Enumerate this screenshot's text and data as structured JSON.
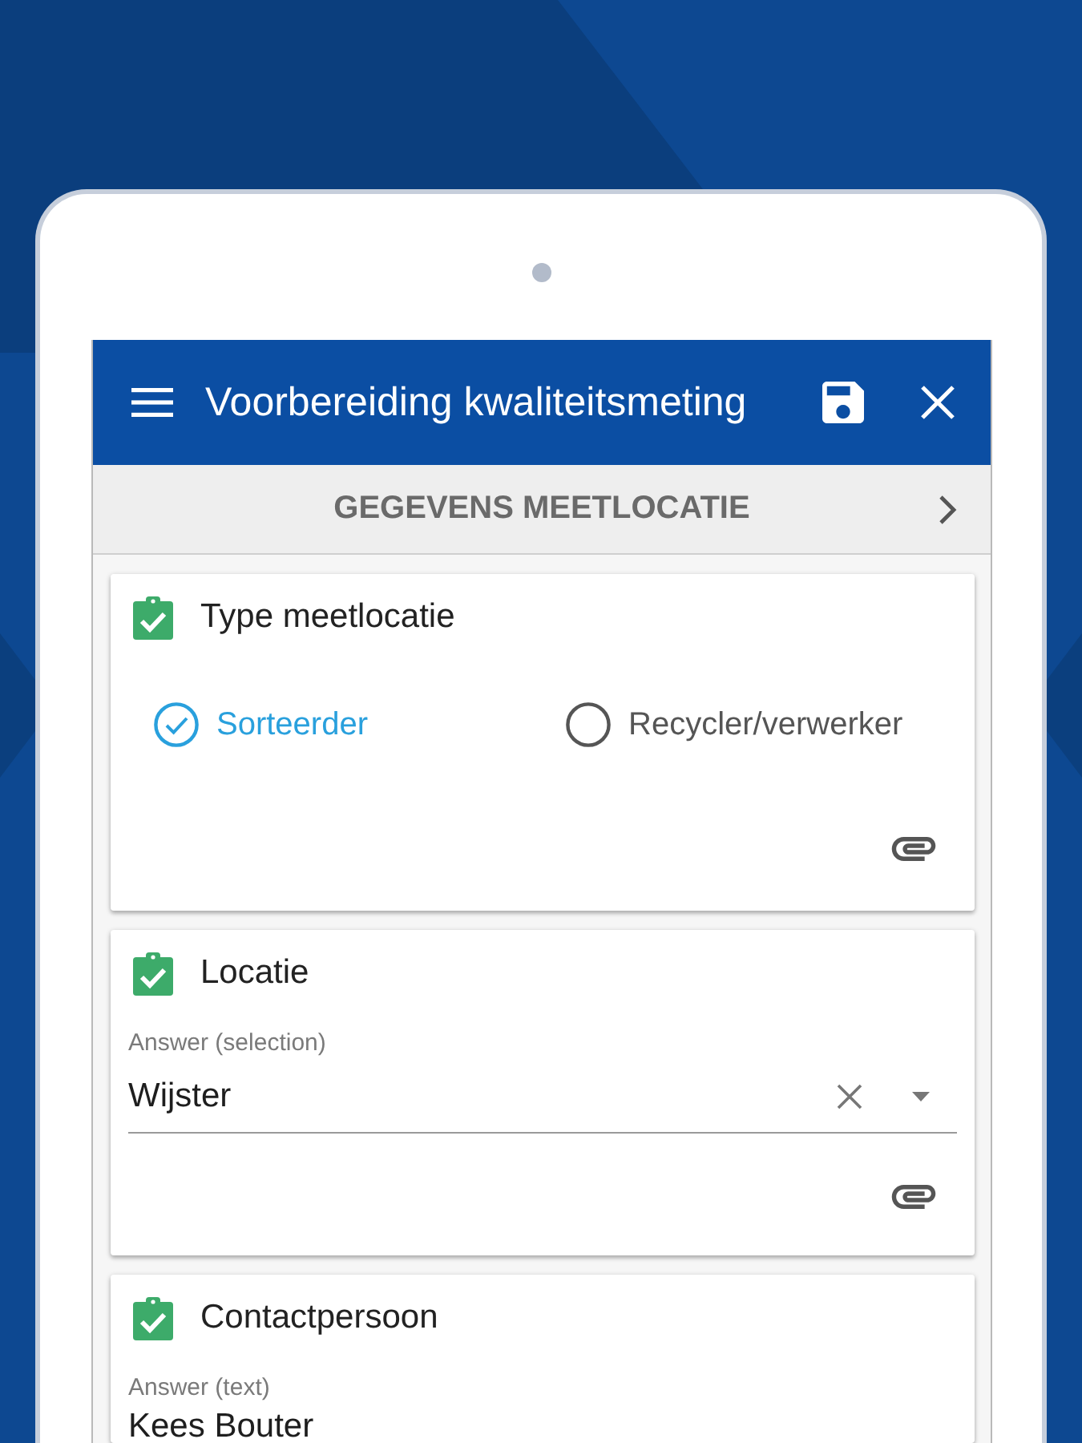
{
  "app_bar": {
    "title": "Voorbereiding kwaliteitsmeting"
  },
  "section": {
    "title": "GEGEVENS MEETLOCATIE"
  },
  "questions": [
    {
      "kind": "radio",
      "title": "Type meetlocatie",
      "completed": true,
      "attachment": true,
      "options": [
        {
          "label": "Sorteerder",
          "selected": true
        },
        {
          "label": "Recycler/verwerker",
          "selected": false
        }
      ]
    },
    {
      "kind": "select",
      "title": "Locatie",
      "completed": true,
      "attachment": true,
      "field_label": "Answer (selection)",
      "value": "Wijster"
    },
    {
      "kind": "text",
      "title": "Contactpersoon",
      "completed": true,
      "attachment": false,
      "field_label": "Answer (text)",
      "value": "Kees Bouter"
    }
  ]
}
